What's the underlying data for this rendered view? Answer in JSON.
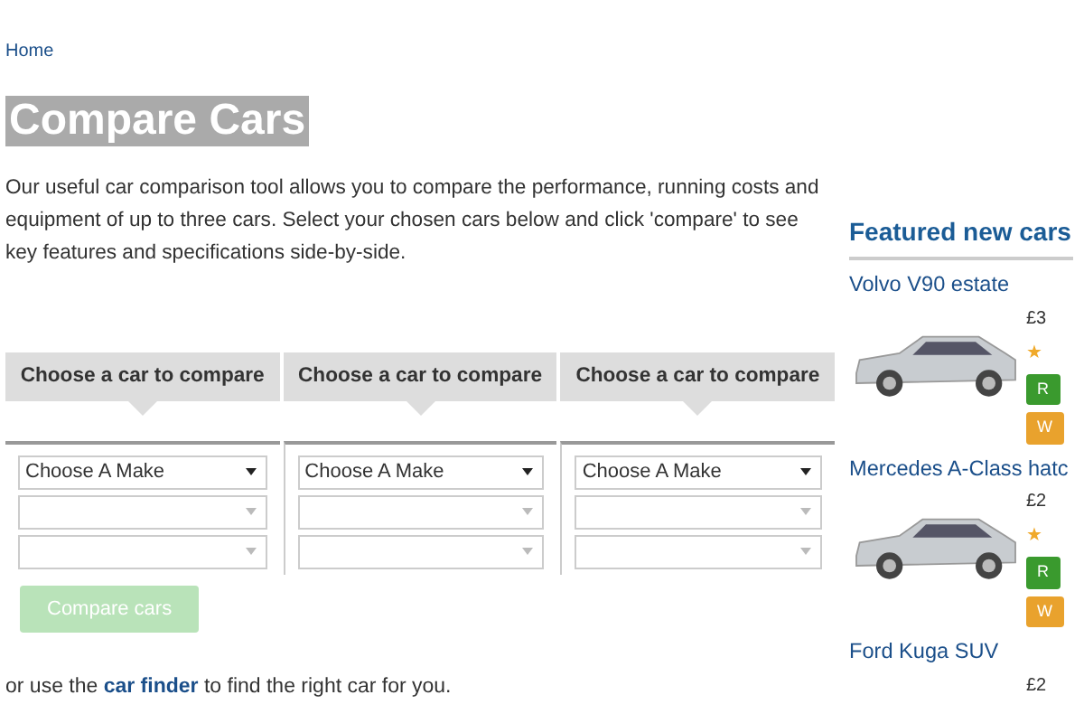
{
  "breadcrumb": [
    {
      "label": "Home"
    }
  ],
  "title": {
    "text": "Compare Cars",
    "highlighted": true
  },
  "intro": "Our useful car comparison tool allows you to compare the performance, running costs and equipment of up to three cars. Select your chosen cars below and click 'compare' to see key features and specifications side-by-side.",
  "columns": [
    {
      "heading": "Choose a car to compare",
      "make": "Choose A Make"
    },
    {
      "heading": "Choose a car to compare",
      "make": "Choose A Make"
    },
    {
      "heading": "Choose a car to compare",
      "make": "Choose A Make"
    }
  ],
  "compare_button": {
    "label": "Compare cars",
    "disabled": true
  },
  "finder_note": {
    "before": "or use the",
    "link": "car finder",
    "after": "to find the right car for you."
  },
  "sidebar": {
    "title": "Featured new cars",
    "cars": [
      {
        "name": "Volvo V90 estate",
        "photo": true,
        "price": "£3",
        "star": "★",
        "review": "R",
        "watch": "W"
      },
      {
        "name": "Mercedes A-Class hatc",
        "photo": true,
        "price": "£2",
        "star": "★",
        "review": "R",
        "watch": "W"
      },
      {
        "name": "Ford Kuga SUV",
        "price": "£2"
      }
    ]
  }
}
